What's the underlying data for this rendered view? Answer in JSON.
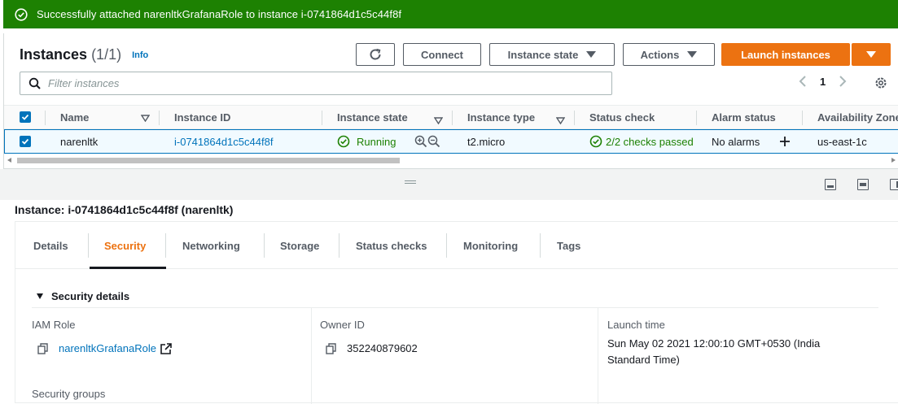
{
  "flash": {
    "message": "Successfully attached narenltkGrafanaRole to instance i-0741864d1c5c44f8f"
  },
  "instances": {
    "title": "Instances",
    "count": "(1/1)",
    "info_link": "Info",
    "buttons": {
      "connect": "Connect",
      "instance_state": "Instance state",
      "actions": "Actions",
      "launch": "Launch instances"
    },
    "filter_placeholder": "Filter instances",
    "page_number": "1",
    "columns": [
      "Name",
      "Instance ID",
      "Instance state",
      "Instance type",
      "Status check",
      "Alarm status",
      "Availability Zone"
    ],
    "row": {
      "name": "narenltk",
      "instance_id": "i-0741864d1c5c44f8f",
      "state": "Running",
      "type": "t2.micro",
      "status_check": "2/2 checks passed",
      "alarm_status": "No alarms",
      "zone": "us-east-1c"
    }
  },
  "details": {
    "title": "Instance: i-0741864d1c5c44f8f (narenltk)",
    "tabs": [
      "Details",
      "Security",
      "Networking",
      "Storage",
      "Status checks",
      "Monitoring",
      "Tags"
    ],
    "active_tab": "Security",
    "section_title": "Security details",
    "fields": {
      "iam_role_label": "IAM Role",
      "iam_role_value": "narenltkGrafanaRole",
      "owner_id_label": "Owner ID",
      "owner_id_value": "352240879602",
      "launch_time_label": "Launch time",
      "launch_time_value": "Sun May 02 2021 12:00:10 GMT+0530 (India Standard Time)",
      "security_groups_label": "Security groups"
    }
  },
  "colors": {
    "success_banner": "#1d8102",
    "primary_orange": "#ec7211",
    "link_blue": "#0073bb"
  },
  "icons": [
    "check-circle-icon",
    "refresh-icon",
    "caret-down-icon",
    "search-icon",
    "chevron-left-icon",
    "chevron-right-icon",
    "gear-icon",
    "zoom-in-icon",
    "zoom-out-icon",
    "plus-icon",
    "copy-icon",
    "external-link-icon"
  ]
}
